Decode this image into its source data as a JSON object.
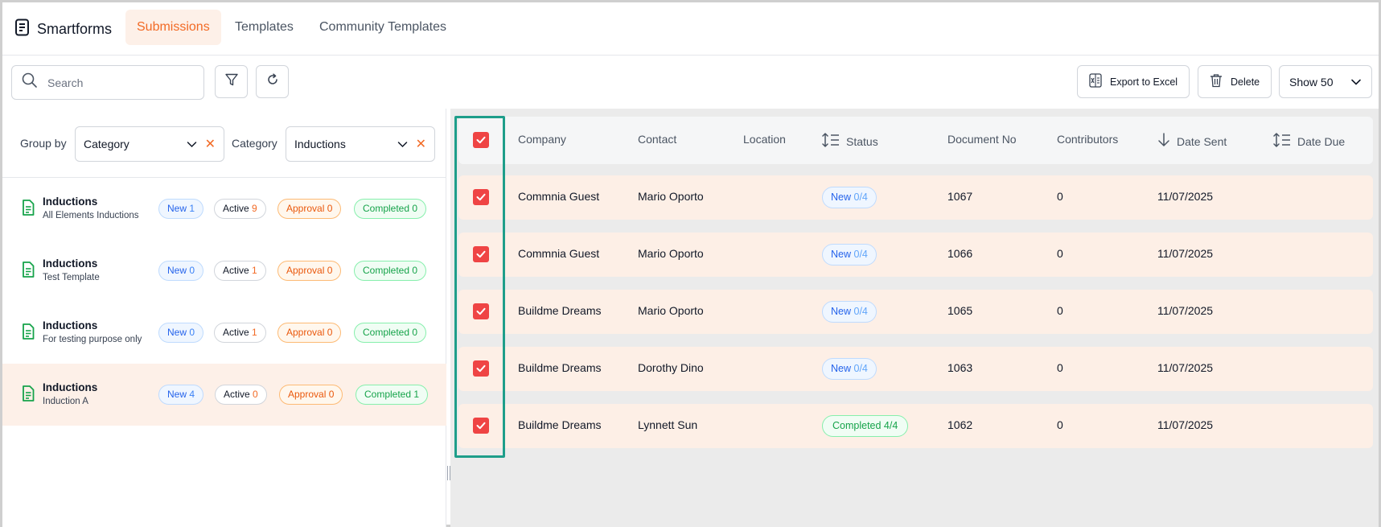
{
  "app": {
    "name": "Smartforms"
  },
  "nav": {
    "tabs": [
      "Submissions",
      "Templates",
      "Community Templates"
    ]
  },
  "toolbar": {
    "search_placeholder": "Search",
    "export_label": "Export to Excel",
    "delete_label": "Delete",
    "show_label": "Show 50"
  },
  "filters": {
    "group_by_label": "Group by",
    "group_by_value": "Category",
    "category_label": "Category",
    "category_value": "Inductions"
  },
  "groups": [
    {
      "title": "Inductions",
      "subtitle": "All Elements Inductions",
      "new_label": "New",
      "new": "1",
      "active_label": "Active",
      "active": "9",
      "approval": "Approval 0",
      "completed": "Completed 0",
      "selected": false
    },
    {
      "title": "Inductions",
      "subtitle": "Test Template",
      "new_label": "New",
      "new": "0",
      "active_label": "Active",
      "active": "1",
      "approval": "Approval 0",
      "completed": "Completed 0",
      "selected": false
    },
    {
      "title": "Inductions",
      "subtitle": "For testing purpose only",
      "new_label": "New",
      "new": "0",
      "active_label": "Active",
      "active": "1",
      "approval": "Approval 0",
      "completed": "Completed 0",
      "selected": false
    },
    {
      "title": "Inductions",
      "subtitle": "Induction A",
      "new_label": "New",
      "new": "4",
      "active_label": "Active",
      "active": "0",
      "approval": "Approval 0",
      "completed": "Completed 1",
      "selected": true
    }
  ],
  "table": {
    "columns": [
      "Company",
      "Contact",
      "Location",
      "Status",
      "Document No",
      "Contributors",
      "Date Sent",
      "Date Due"
    ],
    "rows": [
      {
        "company": "Commnia Guest",
        "contact": "Mario Oporto",
        "location": "",
        "status_label": "New",
        "status_count": "0/4",
        "status_type": "new",
        "doc_no": "1067",
        "contributors": "0",
        "date_sent": "11/07/2025",
        "date_due": ""
      },
      {
        "company": "Commnia Guest",
        "contact": "Mario Oporto",
        "location": "",
        "status_label": "New",
        "status_count": "0/4",
        "status_type": "new",
        "doc_no": "1066",
        "contributors": "0",
        "date_sent": "11/07/2025",
        "date_due": ""
      },
      {
        "company": "Buildme Dreams",
        "contact": "Mario Oporto",
        "location": "",
        "status_label": "New",
        "status_count": "0/4",
        "status_type": "new",
        "doc_no": "1065",
        "contributors": "0",
        "date_sent": "11/07/2025",
        "date_due": ""
      },
      {
        "company": "Buildme Dreams",
        "contact": "Dorothy Dino",
        "location": "",
        "status_label": "New",
        "status_count": "0/4",
        "status_type": "new",
        "doc_no": "1063",
        "contributors": "0",
        "date_sent": "11/07/2025",
        "date_due": ""
      },
      {
        "company": "Buildme Dreams",
        "contact": "Lynnett Sun",
        "location": "",
        "status_label": "Completed 4/4",
        "status_count": "",
        "status_type": "completed",
        "doc_no": "1062",
        "contributors": "0",
        "date_sent": "11/07/2025",
        "date_due": ""
      }
    ]
  },
  "colors": {
    "accent": "#f26a25",
    "row_bg": "#fdefe6",
    "checkbox": "#ef4444",
    "highlight": "#1e9e8a"
  }
}
